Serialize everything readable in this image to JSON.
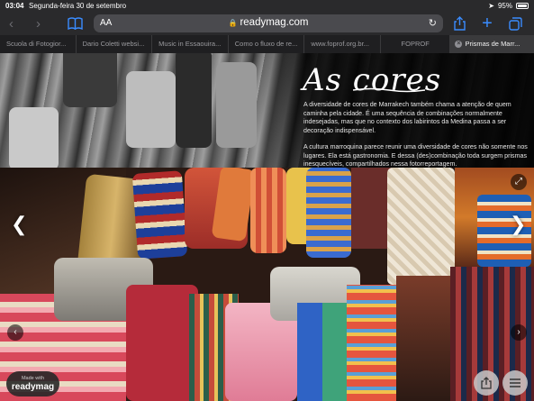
{
  "status_bar": {
    "time": "03:04",
    "date": "Segunda-feira 30 de setembro",
    "battery": "95%"
  },
  "toolbar": {
    "reader_label": "AA",
    "url": "readymag.com"
  },
  "tabs": [
    {
      "label": "Scuola di Fotogior..."
    },
    {
      "label": "Dario Coletti websi..."
    },
    {
      "label": "Music in Essaouira..."
    },
    {
      "label": "Como o fluxo de re..."
    },
    {
      "label": "www.foprof.org.br..."
    },
    {
      "label": "FOPROF"
    },
    {
      "label": "Prismas de Marr...",
      "active": true
    }
  ],
  "article": {
    "title": "As cores",
    "paragraph_1": "A diversidade de cores de Marrakech também chama a atenção de quem caminha pela cidade. É uma sequência de combinações normalmente indesejadas, mas que no contexto dos labirintos da Medina passa a ser decoração indispensável.",
    "paragraph_2": "A cultura marroquina parece reunir uma diversidade de cores não somente nos lugares. Ela está gastronomia. E dessa (des)combinação toda surgem prismas inesquecíveis, compartilhados nessa fotorreportagem."
  },
  "badge": {
    "made_with": "Made with",
    "brand": "readymag"
  },
  "colors": {
    "accent": "#3a8cff",
    "chrome": "#2a2a2c",
    "tab_bar": "#1f1f21"
  },
  "icons": {
    "back": "chevron-left-icon",
    "forward": "chevron-right-icon",
    "bookmarks": "book-icon",
    "share": "share-icon",
    "new_tab": "plus-icon",
    "tabs": "tabs-icon",
    "reload": "reload-icon",
    "expand": "expand-icon",
    "menu": "menu-icon"
  }
}
